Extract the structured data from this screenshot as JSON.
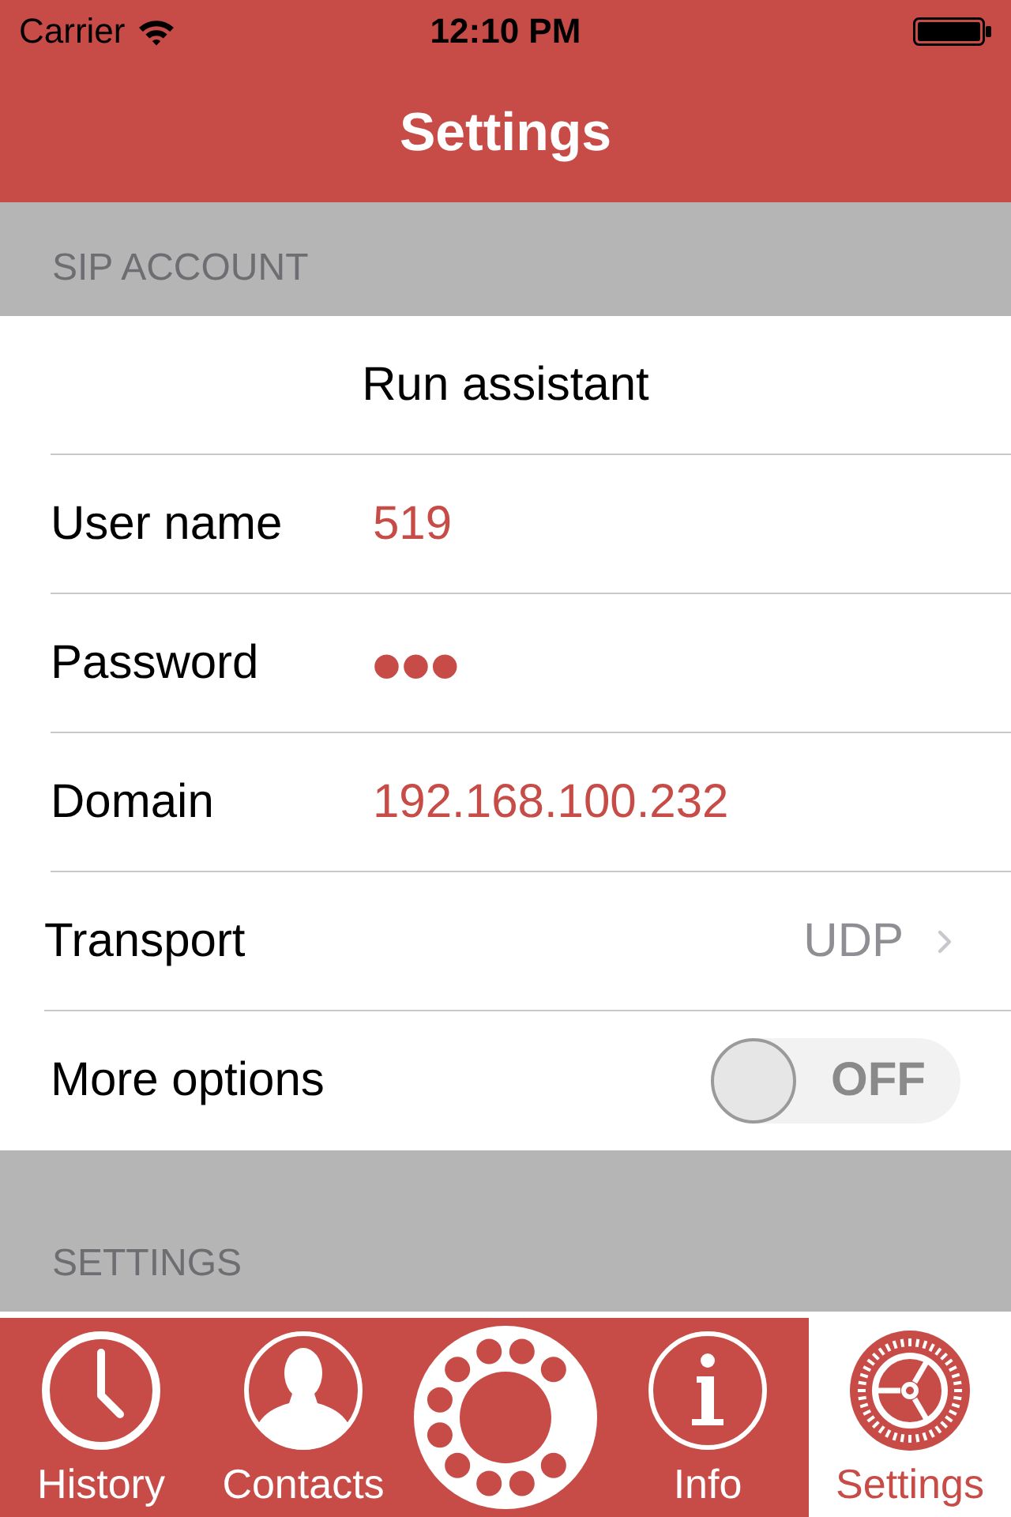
{
  "status_bar": {
    "carrier": "Carrier",
    "time": "12:10 PM"
  },
  "nav_bar": {
    "title": "Settings"
  },
  "sections": [
    {
      "header": "SIP ACCOUNT",
      "rows": [
        {
          "kind": "action",
          "label": "Run assistant"
        },
        {
          "kind": "text",
          "label": "User name",
          "value": "519"
        },
        {
          "kind": "secure",
          "label": "Password",
          "value": "●●●"
        },
        {
          "kind": "text",
          "label": "Domain",
          "value": "192.168.100.232"
        },
        {
          "kind": "disclosure",
          "label": "Transport",
          "value": "UDP"
        },
        {
          "kind": "switch",
          "label": "More options",
          "on": false,
          "state_text": "OFF"
        }
      ]
    },
    {
      "header": "SETTINGS"
    }
  ],
  "tab_bar": [
    {
      "kind": "history",
      "label": "History",
      "selected": false
    },
    {
      "kind": "contacts",
      "label": "Contacts",
      "selected": false
    },
    {
      "kind": "dialer",
      "selected": false
    },
    {
      "kind": "info",
      "label": "Info",
      "selected": false
    },
    {
      "kind": "settings",
      "label": "Settings",
      "selected": true
    }
  ]
}
